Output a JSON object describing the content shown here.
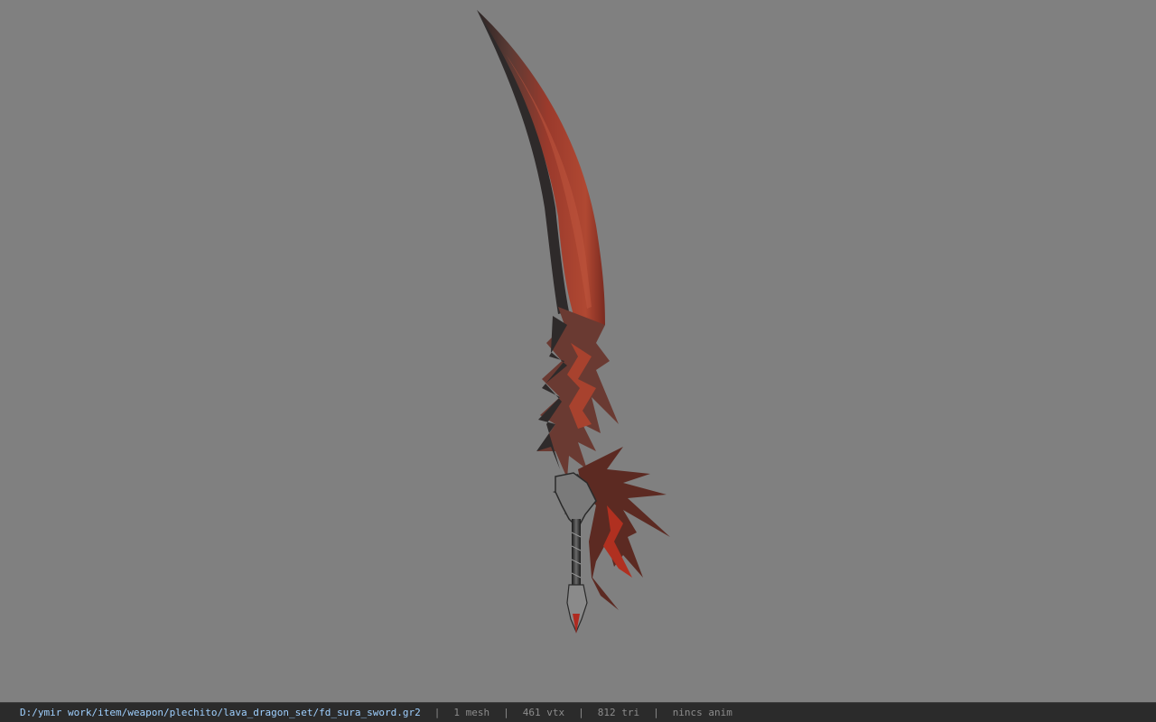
{
  "viewer": {
    "background_color": "#808080",
    "model_name": "fd_sura_sword"
  },
  "status_bar": {
    "file_path": "D:/ymir work/item/weapon/plechito/lava_dragon_set/fd_sura_sword.gr2",
    "separator": "|",
    "mesh_count": "1 mesh",
    "vertex_count": "461 vtx",
    "triangle_count": "812 tri",
    "anim_status": "nincs anim",
    "path_color": "#9fd0ff",
    "bar_color": "#2b2b2b"
  }
}
